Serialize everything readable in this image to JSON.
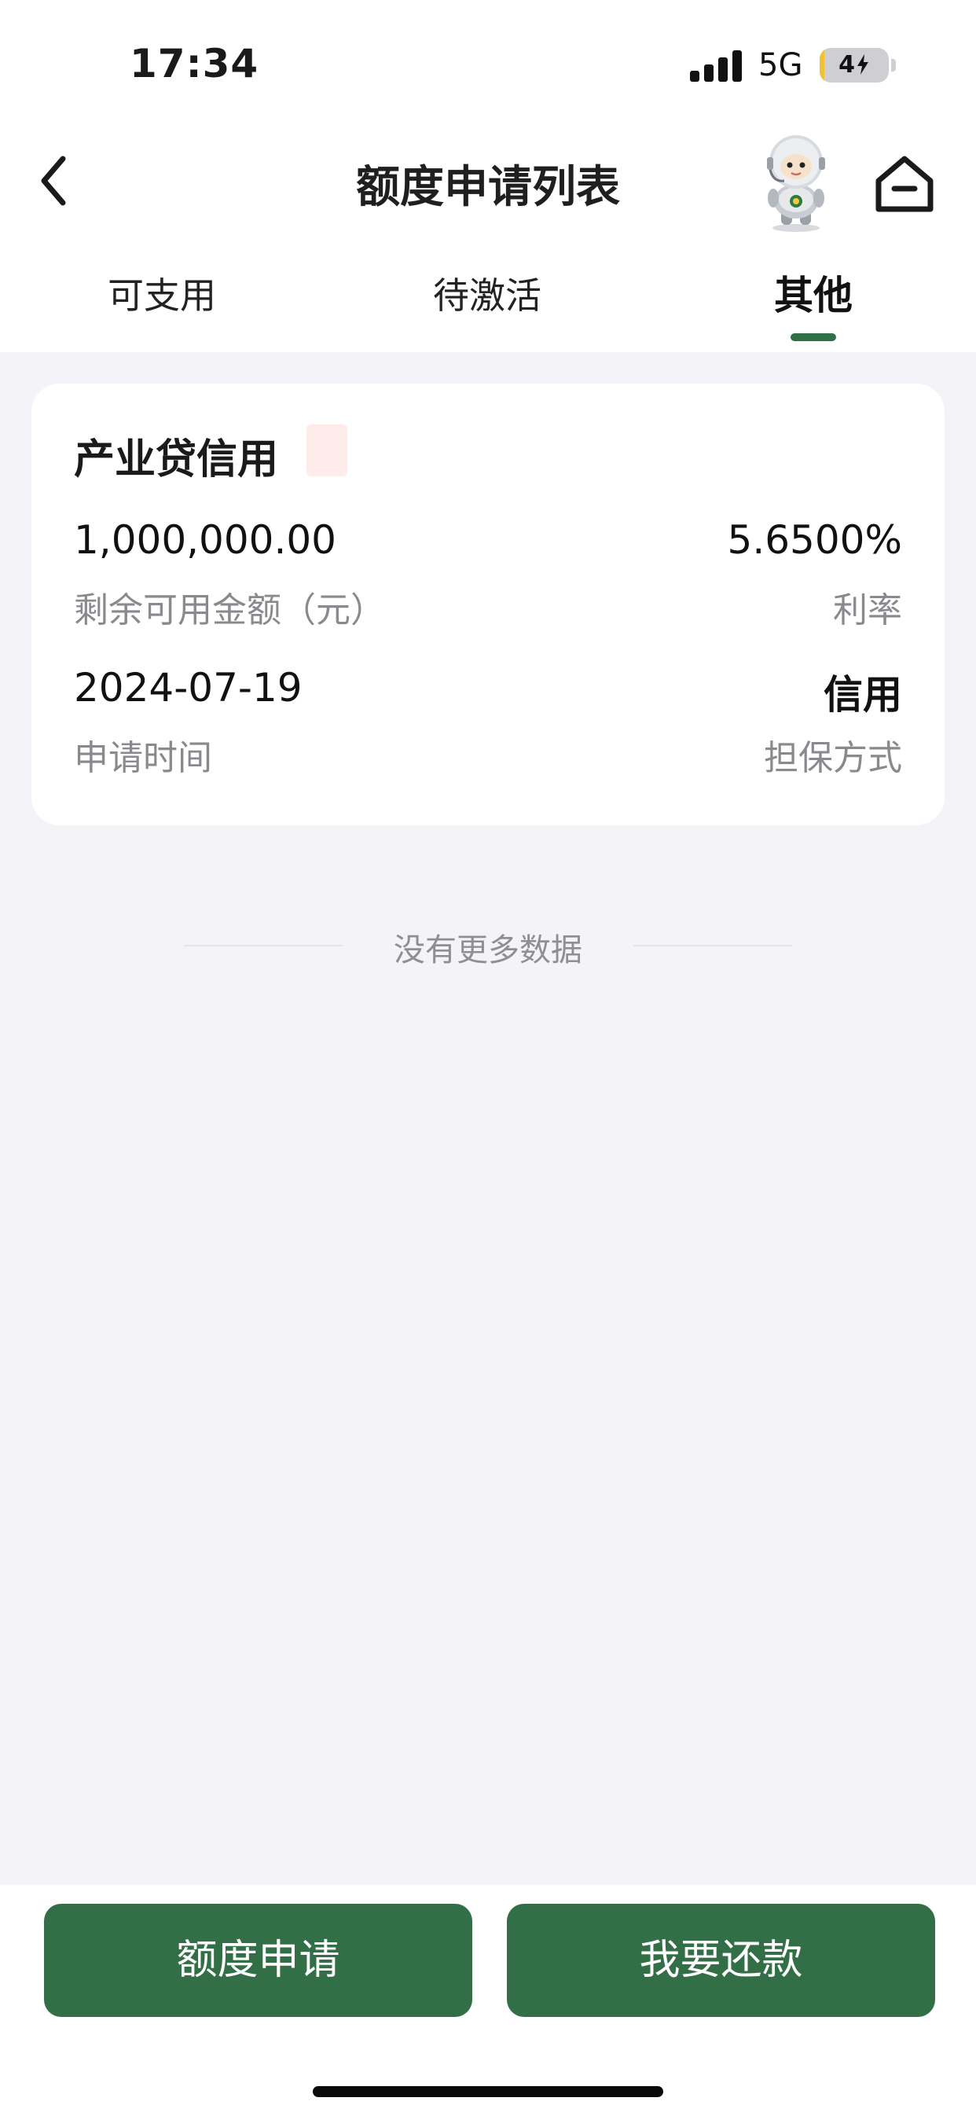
{
  "status_bar": {
    "time": "17:34",
    "network": "5G",
    "battery_level": "4",
    "battery_fraction": 0.04
  },
  "header": {
    "title": "额度申请列表"
  },
  "tabs": [
    {
      "label": "可支用",
      "active": false
    },
    {
      "label": "待激活",
      "active": false
    },
    {
      "label": "其他",
      "active": true
    }
  ],
  "card": {
    "title": "产业贷信用",
    "amount_value": "1,000,000.00",
    "amount_label": "剩余可用金额（元）",
    "rate_value": "5.6500%",
    "rate_label": "利率",
    "date_value": "2024-07-19",
    "date_label": "申请时间",
    "guarantee_value": "信用",
    "guarantee_label": "担保方式"
  },
  "no_more_text": "没有更多数据",
  "buttons": {
    "apply_label": "额度申请",
    "repay_label": "我要还款"
  },
  "colors": {
    "accent": "#336f46",
    "background": "#f4f4f8"
  }
}
